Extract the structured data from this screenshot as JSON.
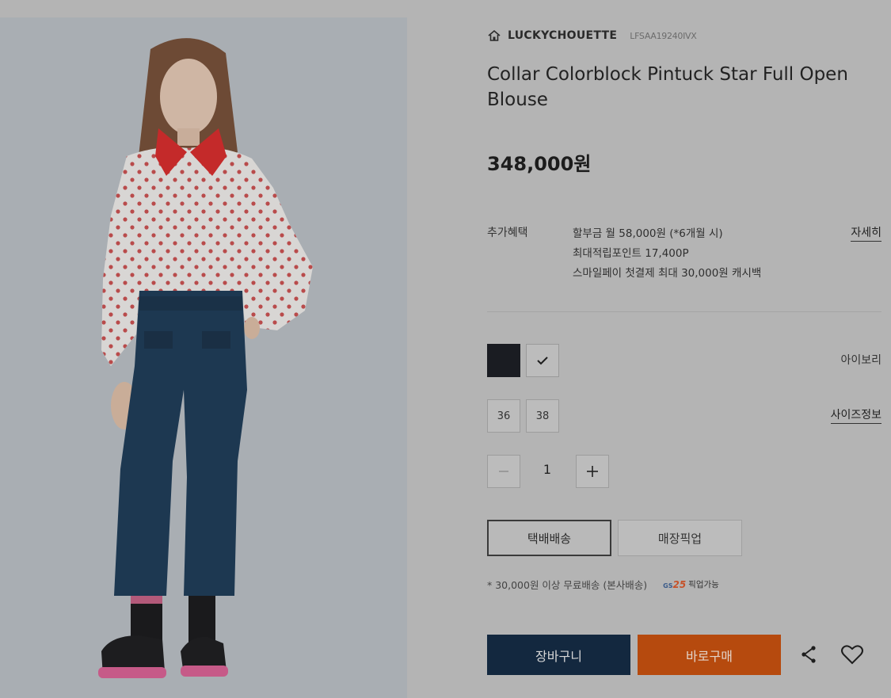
{
  "product": {
    "brand": "LUCKYCHOUETTE",
    "sku": "LFSAA19240IVX",
    "title": "Collar Colorblock Pintuck Star Full Open Blouse",
    "price": "348,000원"
  },
  "benefits": {
    "label": "추가혜택",
    "lines": [
      "할부금 월 58,000원 (*6개월 시)",
      "최대적립포인트 17,400P",
      "스마일페이 첫결제 최대 30,000원 캐시백"
    ],
    "detail_link": "자세히"
  },
  "color": {
    "options": [
      {
        "name": "black",
        "hex": "#1a1c22",
        "selected": false
      },
      {
        "name": "ivory",
        "hex": "#bcbcbc",
        "selected": true
      }
    ],
    "selected_name": "아이보리"
  },
  "size": {
    "options": [
      "36",
      "38"
    ],
    "info_link": "사이즈정보"
  },
  "quantity": {
    "value": "1"
  },
  "shipping": {
    "options": [
      "택배배송",
      "매장픽업"
    ],
    "selected": "택배배송",
    "note": "* 30,000원 이상 무료배송 (본사배송)",
    "gs_brand": "GS25",
    "gs_label": "픽업가능"
  },
  "actions": {
    "cart": "장바구니",
    "buy": "바로구매"
  },
  "colors": {
    "cart_bg": "#13283f",
    "buy_bg": "#b64a0e",
    "page_bg": "#b4b4b4"
  }
}
